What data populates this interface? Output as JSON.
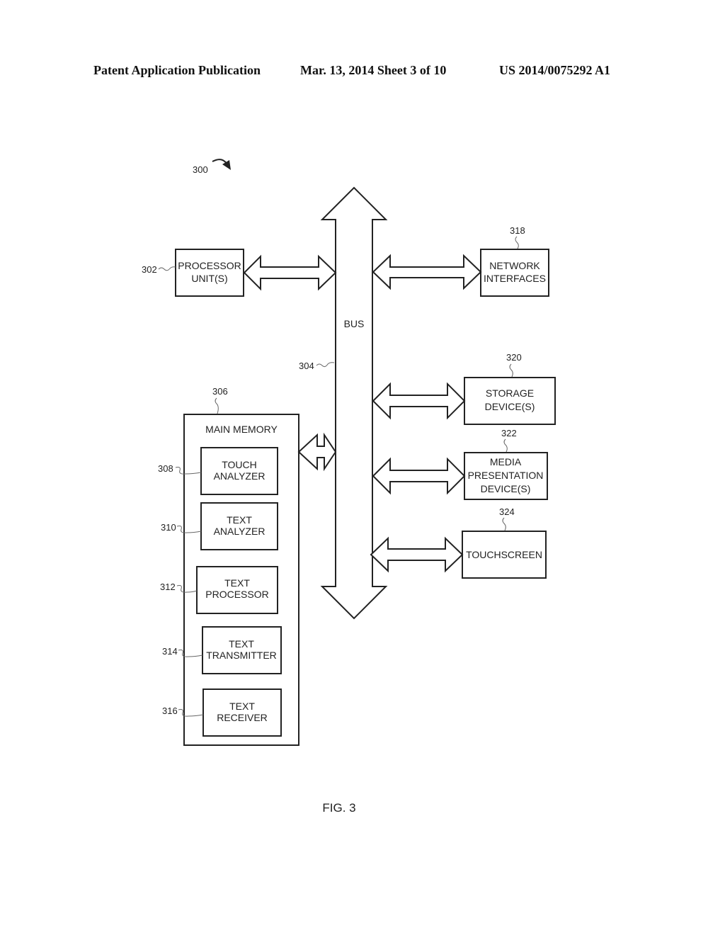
{
  "header": {
    "left": "Patent Application Publication",
    "center": "Mar. 13, 2014  Sheet 3 of 10",
    "right": "US 2014/0075292 A1"
  },
  "figure": {
    "ref": "300",
    "caption": "FIG. 3",
    "bus": {
      "ref": "304",
      "label": "BUS"
    },
    "processor": {
      "ref": "302",
      "lines": [
        "PROCESSOR",
        "UNIT(S)"
      ]
    },
    "main_memory": {
      "ref": "306",
      "label": "MAIN MEMORY",
      "modules": [
        {
          "ref": "308",
          "lines": [
            "TOUCH",
            "ANALYZER"
          ]
        },
        {
          "ref": "310",
          "lines": [
            "TEXT",
            "ANALYZER"
          ]
        },
        {
          "ref": "312",
          "lines": [
            "TEXT",
            "PROCESSOR"
          ]
        },
        {
          "ref": "314",
          "lines": [
            "TEXT",
            "TRANSMITTER"
          ]
        },
        {
          "ref": "316",
          "lines": [
            "TEXT",
            "RECEIVER"
          ]
        }
      ]
    },
    "network": {
      "ref": "318",
      "lines": [
        "NETWORK",
        "INTERFACES"
      ]
    },
    "storage": {
      "ref": "320",
      "lines": [
        "STORAGE",
        "DEVICE(S)"
      ]
    },
    "media": {
      "ref": "322",
      "lines": [
        "MEDIA",
        "PRESENTATION",
        "DEVICE(S)"
      ]
    },
    "touchscreen": {
      "ref": "324",
      "lines": [
        "TOUCHSCREEN"
      ]
    }
  }
}
